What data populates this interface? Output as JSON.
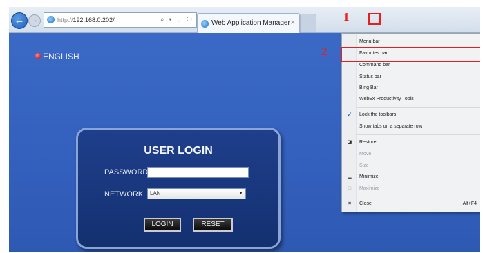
{
  "browser": {
    "address_protocol": "http://",
    "address_host": "192.168.0.202/",
    "address_tools": "⌕ ▾ ▯ ↻",
    "tab_title": "Web Application Manager",
    "tab_close": "×"
  },
  "page": {
    "language_label": "ENGLISH",
    "login": {
      "heading": "USER LOGIN",
      "password_label": "PASSWORD",
      "password_value": "",
      "network_label": "NETWORK",
      "network_value": "LAN",
      "login_button": "LOGIN",
      "reset_button": "RESET"
    }
  },
  "context_menu": {
    "items": [
      {
        "label": "Menu bar"
      },
      {
        "label": "Favorites bar"
      },
      {
        "label": "Command bar"
      },
      {
        "label": "Status bar"
      },
      {
        "label": "Bing Bar"
      },
      {
        "label": "WebEx Productivity Tools"
      },
      {
        "label": "Lock the toolbars",
        "mark": "✓"
      },
      {
        "label": "Show tabs on a separate row"
      },
      {
        "label": "Restore",
        "mark": "◪"
      },
      {
        "label": "Move",
        "disabled": true
      },
      {
        "label": "Size",
        "disabled": true
      },
      {
        "label": "Minimize",
        "mark": "▁"
      },
      {
        "label": "Maximize",
        "mark": "□",
        "disabled": true
      },
      {
        "label": "Close",
        "mark": "×",
        "shortcut": "Alt+F4"
      }
    ]
  },
  "annotations": {
    "step1": "1",
    "step2": "2",
    "color": "#e81e1e"
  }
}
